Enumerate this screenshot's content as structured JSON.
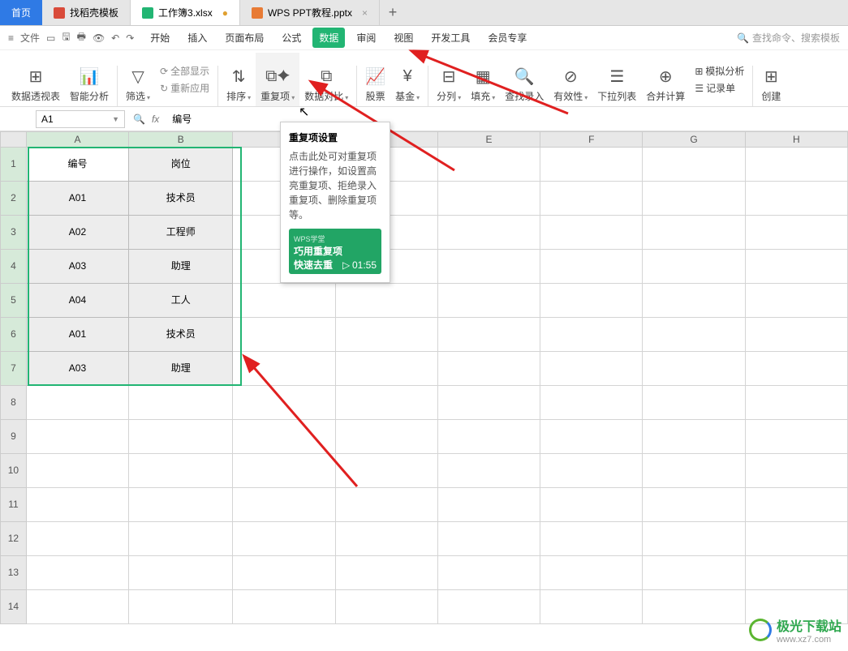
{
  "tabs": {
    "home": "首页",
    "t1": "找稻壳模板",
    "t2": "工作簿3.xlsx",
    "t3": "WPS PPT教程.pptx"
  },
  "menu": {
    "file": "文件",
    "items": [
      "开始",
      "插入",
      "页面布局",
      "公式",
      "数据",
      "审阅",
      "视图",
      "开发工具",
      "会员专享"
    ],
    "search": "查找命令、搜索模板"
  },
  "ribbon": {
    "pivot": "数据透视表",
    "smart": "智能分析",
    "filter": "筛选",
    "showall": "全部显示",
    "reapply": "重新应用",
    "sort": "排序",
    "dup": "重复项",
    "compare": "数据对比",
    "stock": "股票",
    "fund": "基金",
    "split": "分列",
    "fill": "填充",
    "lookup": "查找录入",
    "valid": "有效性",
    "dropdown": "下拉列表",
    "consol": "合并计算",
    "sim": "模拟分析",
    "record": "记录单",
    "create": "创建"
  },
  "namebox": "A1",
  "formula": "编号",
  "cols": [
    "A",
    "B",
    "C",
    "D",
    "E",
    "F",
    "G",
    "H"
  ],
  "rows": [
    "1",
    "2",
    "3",
    "4",
    "5",
    "6",
    "7",
    "8",
    "9",
    "10",
    "11",
    "12",
    "13",
    "14"
  ],
  "data": {
    "h1": "编号",
    "h2": "岗位",
    "r1a": "A01",
    "r1b": "技术员",
    "r2a": "A02",
    "r2b": "工程师",
    "r3a": "A03",
    "r3b": "助理",
    "r4a": "A04",
    "r4b": "工人",
    "r5a": "A01",
    "r5b": "技术员",
    "r6a": "A03",
    "r6b": "助理"
  },
  "tooltip": {
    "title": "重复项设置",
    "desc": "点击此处可对重复项进行操作，如设置高亮重复项、拒绝录入重复项、删除重复项等。",
    "vtag": "WPS学堂",
    "vl1": "巧用重复项",
    "vl2": "快速去重",
    "time": "01:55"
  },
  "watermark": {
    "t1": "极光下载站",
    "t2": "www.xz7.com"
  }
}
